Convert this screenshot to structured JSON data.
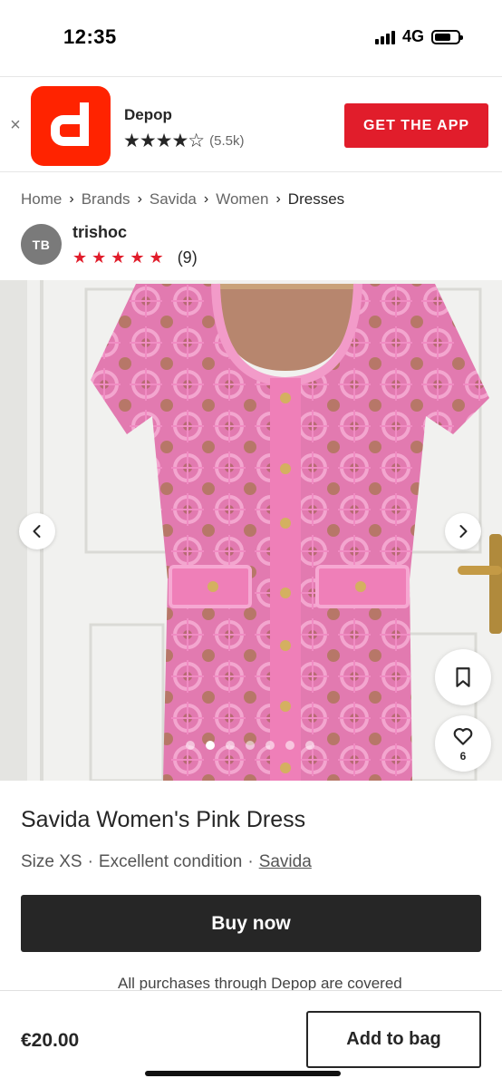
{
  "status_bar": {
    "time": "12:35",
    "network": "4G"
  },
  "app_banner": {
    "app_name": "Depop",
    "rating_count": "(5.5k)",
    "stars": "★★★★☆",
    "cta": "GET THE APP",
    "close": "×",
    "brand_color": "#e11d2b"
  },
  "breadcrumb": {
    "items": [
      "Home",
      "Brands",
      "Savida",
      "Women",
      "Dresses"
    ],
    "separator": "›"
  },
  "seller": {
    "initials": "TB",
    "username": "trishoc",
    "stars": "★★★★★",
    "review_count": "(9)"
  },
  "gallery": {
    "image_count": 7,
    "active_index": 1,
    "like_count": "6",
    "dress_color": "#e87bb7"
  },
  "product": {
    "title": "Savida Women's Pink Dress",
    "size": "Size XS",
    "condition": "Excellent condition",
    "brand_link": "Savida",
    "separator": "·",
    "buy_now": "Buy now",
    "protection_note": "All purchases through Depop are covered"
  },
  "bottom_bar": {
    "price": "€20.00",
    "add_to_bag": "Add to bag"
  }
}
